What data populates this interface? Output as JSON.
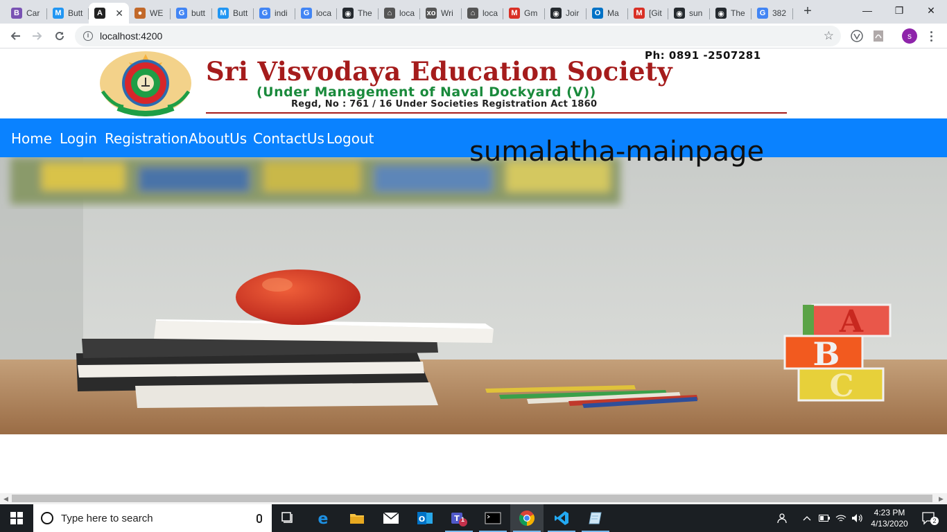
{
  "browser": {
    "tabs": [
      {
        "title": "Car",
        "favicon": "bootstrap-icon",
        "color": "#7952b3",
        "glyph": "B"
      },
      {
        "title": "Butt",
        "favicon": "material-icon",
        "color": "#2196f3",
        "glyph": "M"
      },
      {
        "title": "",
        "favicon": "angular-icon",
        "color": "#222222",
        "glyph": "A",
        "active": true
      },
      {
        "title": "WE",
        "favicon": "school-logo-icon",
        "color": "#c2692a",
        "glyph": "●"
      },
      {
        "title": "butt",
        "favicon": "google-icon",
        "color": "#4285f4",
        "glyph": "G"
      },
      {
        "title": "Butt",
        "favicon": "material-icon",
        "color": "#2196f3",
        "glyph": "M"
      },
      {
        "title": "indi",
        "favicon": "google-icon",
        "color": "#4285f4",
        "glyph": "G"
      },
      {
        "title": "loca",
        "favicon": "google-icon",
        "color": "#4285f4",
        "glyph": "G"
      },
      {
        "title": "The",
        "favicon": "github-icon",
        "color": "#24292e",
        "glyph": "◉"
      },
      {
        "title": "loca",
        "favicon": "code-icon",
        "color": "#555555",
        "glyph": "⌂"
      },
      {
        "title": "Wri",
        "favicon": "xo-icon",
        "color": "#555555",
        "glyph": "xo"
      },
      {
        "title": "loca",
        "favicon": "code-icon",
        "color": "#555555",
        "glyph": "⌂"
      },
      {
        "title": "Gm",
        "favicon": "gmail-icon",
        "color": "#d93025",
        "glyph": "M"
      },
      {
        "title": "Joir",
        "favicon": "github-icon",
        "color": "#24292e",
        "glyph": "◉"
      },
      {
        "title": "Ma",
        "favicon": "outlook-icon",
        "color": "#0072c6",
        "glyph": "O"
      },
      {
        "title": "[Git",
        "favicon": "gmail-icon",
        "color": "#d93025",
        "glyph": "M"
      },
      {
        "title": "sun",
        "favicon": "github-icon",
        "color": "#24292e",
        "glyph": "◉"
      },
      {
        "title": "The",
        "favicon": "github-icon",
        "color": "#24292e",
        "glyph": "◉"
      },
      {
        "title": "382",
        "favicon": "google-icon",
        "color": "#4285f4",
        "glyph": "G"
      }
    ],
    "active_tab_close": "✕",
    "new_tab_label": "+",
    "window_controls": [
      "—",
      "❐",
      "✕"
    ],
    "url": "localhost:4200",
    "profile_initial": "s"
  },
  "site": {
    "phone": "Ph: 0891 -2507281",
    "society_name": "Sri Visvodaya Education Society",
    "management": "(Under Management of Naval Dockyard (V))",
    "registration": "Regd, No : 761 / 16 Under Societies Registration Act 1860",
    "nav": [
      "Home",
      "Login",
      "Registration",
      "AboutUs",
      "ContactUs",
      "Logout"
    ],
    "heading": "sumalatha-mainpage",
    "colors": {
      "navbar": "#0a82ff",
      "brand_red": "#a51c1c",
      "brand_green": "#1a8a3c"
    }
  },
  "taskbar": {
    "search_placeholder": "Type here to search",
    "apps": [
      "task-view-icon",
      "edge-icon",
      "file-explorer-icon",
      "mail-icon",
      "outlook-icon",
      "teams-icon",
      "terminal-icon",
      "chrome-icon",
      "vscode-icon",
      "notepad-icon"
    ],
    "teams_badge": "1",
    "time": "4:23 PM",
    "date": "4/13/2020",
    "notification_count": "2"
  }
}
